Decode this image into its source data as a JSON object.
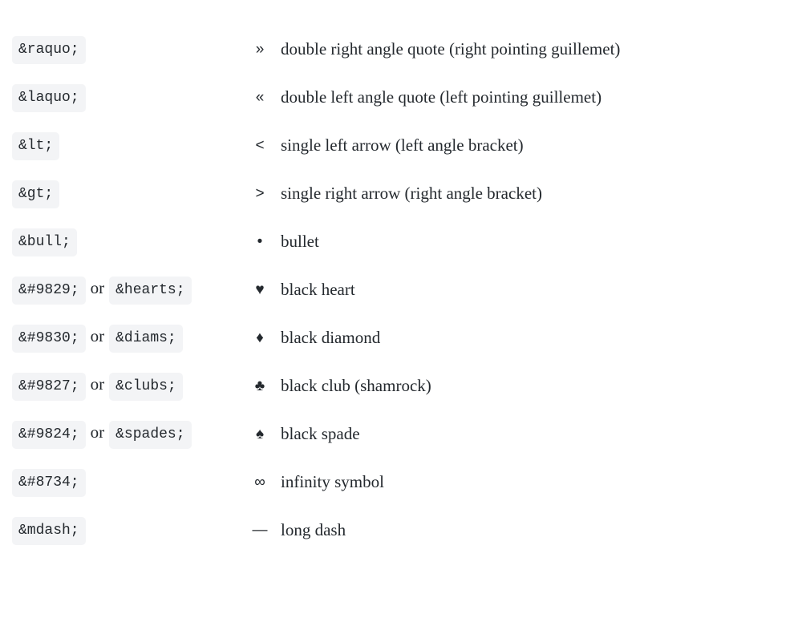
{
  "separator": "or",
  "rows": [
    {
      "codes": [
        "&raquo;"
      ],
      "symbol": "»",
      "desc": "double right angle quote (right pointing guillemet)"
    },
    {
      "codes": [
        "&laquo;"
      ],
      "symbol": "«",
      "desc": "double left angle quote (left pointing guillemet)"
    },
    {
      "codes": [
        "&lt;"
      ],
      "symbol": "<",
      "desc": "single left arrow (left angle bracket)"
    },
    {
      "codes": [
        "&gt;"
      ],
      "symbol": ">",
      "desc": "single right arrow (right angle bracket)"
    },
    {
      "codes": [
        "&bull;"
      ],
      "symbol": "•",
      "desc": "bullet"
    },
    {
      "codes": [
        "&#9829;",
        "&hearts;"
      ],
      "symbol": "♥",
      "desc": "black heart"
    },
    {
      "codes": [
        "&#9830;",
        "&diams;"
      ],
      "symbol": "♦",
      "desc": "black diamond"
    },
    {
      "codes": [
        "&#9827;",
        "&clubs;"
      ],
      "symbol": "♣",
      "desc": "black club (shamrock)"
    },
    {
      "codes": [
        "&#9824;",
        "&spades;"
      ],
      "symbol": "♠",
      "desc": "black spade"
    },
    {
      "codes": [
        "&#8734;"
      ],
      "symbol": "∞",
      "desc": "infinity symbol"
    },
    {
      "codes": [
        "&mdash;"
      ],
      "symbol": "—",
      "desc": "long dash"
    }
  ]
}
